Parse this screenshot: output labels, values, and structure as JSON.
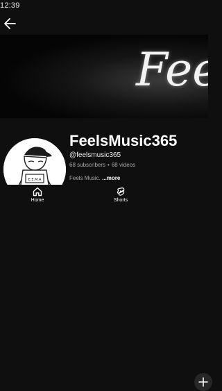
{
  "status_bar": {
    "time": "12:39"
  },
  "header": {
    "back_icon": "arrow-left-icon"
  },
  "banner": {
    "text": "Feels"
  },
  "channel": {
    "name": "FeelsMusic365",
    "handle": "@feelsmusic365",
    "subscribers": "68 subscribers",
    "videos": "68 videos",
    "separator": "•",
    "description": "Feels Music.",
    "more_label": "...more",
    "avatar_badge": "E.E.M.A"
  },
  "bottom_nav": {
    "items": [
      {
        "label": "Home",
        "icon": "home-icon"
      },
      {
        "label": "Shorts",
        "icon": "shorts-icon"
      }
    ],
    "create_icon": "plus-icon"
  },
  "colors": {
    "background": "#0f0f0f",
    "text": "#ffffff",
    "secondary_text": "#aaaaaa"
  }
}
